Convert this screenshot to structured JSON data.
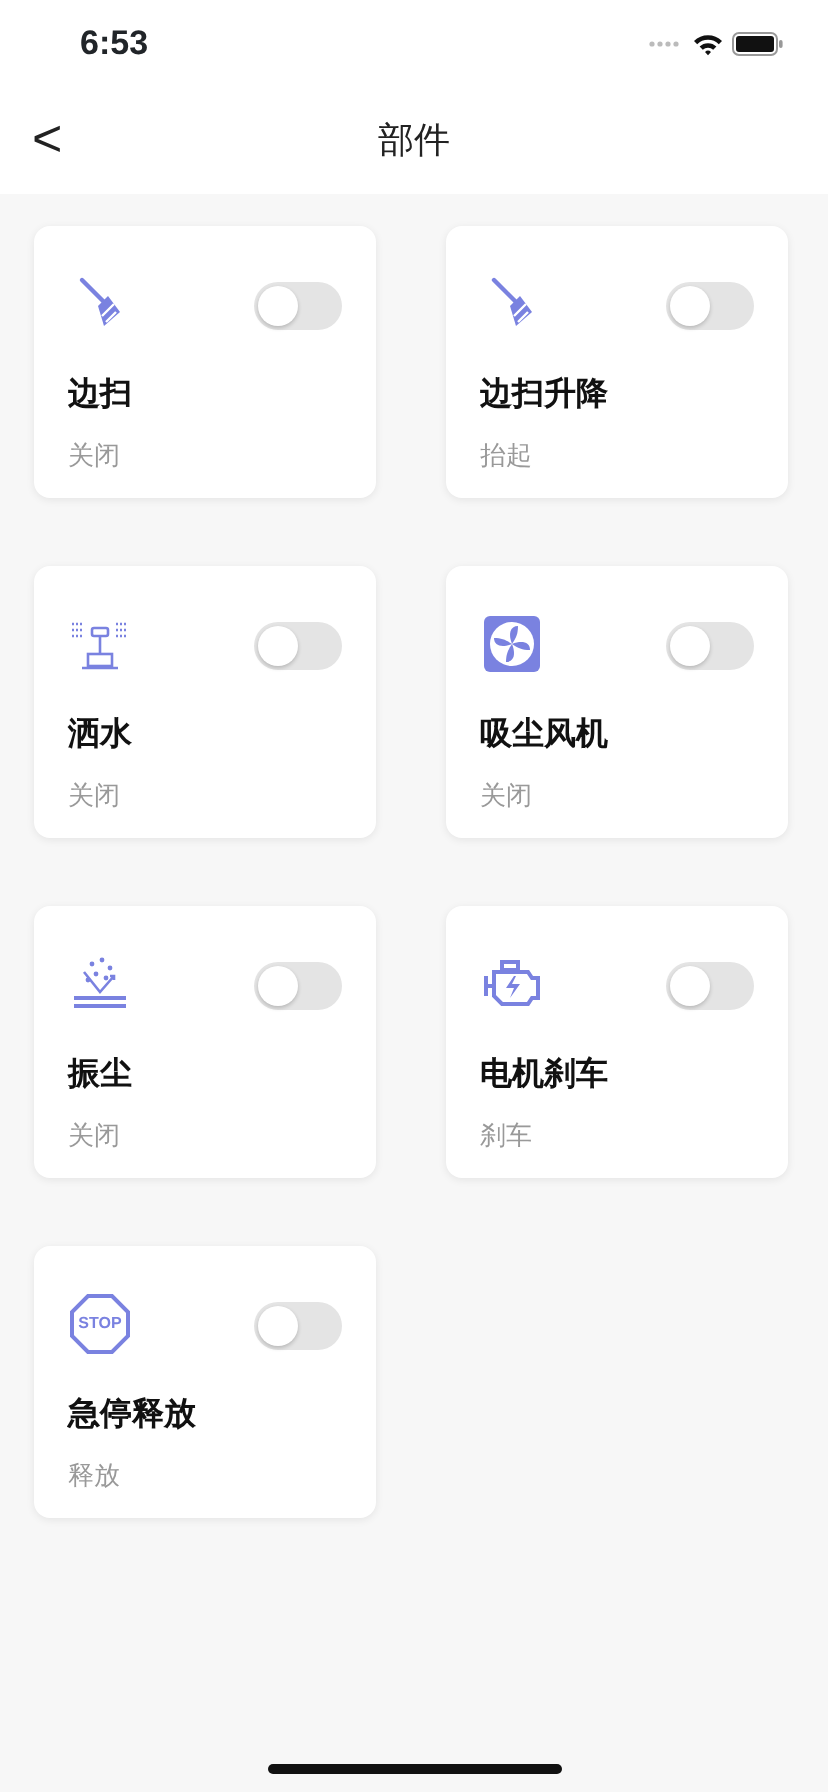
{
  "status_bar": {
    "time": "6:53"
  },
  "nav": {
    "back": "<",
    "title": "部件"
  },
  "components": [
    {
      "kind": "broom",
      "name": "边扫",
      "state": "关闭",
      "on": false
    },
    {
      "kind": "broom",
      "name": "边扫升降",
      "state": "抬起",
      "on": false
    },
    {
      "kind": "sprinkler",
      "name": "洒水",
      "state": "关闭",
      "on": false
    },
    {
      "kind": "fan",
      "name": "吸尘风机",
      "state": "关闭",
      "on": false
    },
    {
      "kind": "dust",
      "name": "振尘",
      "state": "关闭",
      "on": false
    },
    {
      "kind": "engine",
      "name": "电机刹车",
      "state": "刹车",
      "on": false
    },
    {
      "kind": "stop",
      "icon_text": "STOP",
      "name": "急停释放",
      "state": "释放",
      "on": false
    }
  ]
}
